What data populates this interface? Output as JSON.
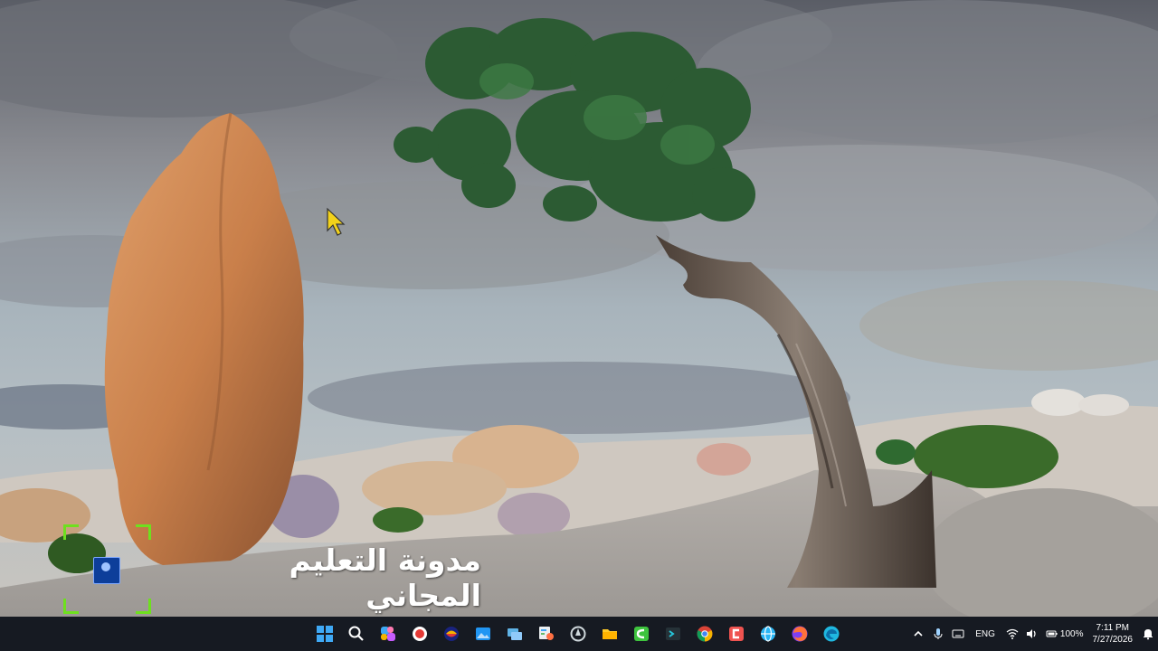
{
  "desktop": {
    "watermark_text": "مدونة التعليم المجاني",
    "cursor_color": "#f2d21b"
  },
  "taskbar": {
    "background": "#161a22",
    "pinned_apps": [
      {
        "name": "start-icon",
        "color": "#3fa9f5"
      },
      {
        "name": "search-icon",
        "color": "#ffffff"
      },
      {
        "name": "copilot-icon",
        "color": "#c85cff"
      },
      {
        "name": "screen-recorder-icon",
        "color": "#e53935"
      },
      {
        "name": "app-icon",
        "color": "#f4b400"
      },
      {
        "name": "photos-icon",
        "color": "#2196f3"
      },
      {
        "name": "task-view-icon",
        "color": "#5fb3e6"
      },
      {
        "name": "paint-icon",
        "color": "#ff7043"
      },
      {
        "name": "app-circle-icon",
        "color": "#cfd8dc"
      },
      {
        "name": "file-explorer-icon",
        "color": "#ffca28"
      },
      {
        "name": "camtasia-icon",
        "color": "#3ec43e"
      },
      {
        "name": "terminal-icon",
        "color": "#26c6da"
      },
      {
        "name": "chrome-icon",
        "color": "#4caf50"
      },
      {
        "name": "app-red-icon",
        "color": "#ef5350"
      },
      {
        "name": "globe-icon",
        "color": "#29b6f6"
      },
      {
        "name": "firefox-icon",
        "color": "#ff7139"
      },
      {
        "name": "edge-icon",
        "color": "#1fb7e0"
      }
    ],
    "tray": {
      "language": "ENG",
      "battery": "100%",
      "time": "7:11 PM",
      "date": "7/27/2026"
    }
  }
}
